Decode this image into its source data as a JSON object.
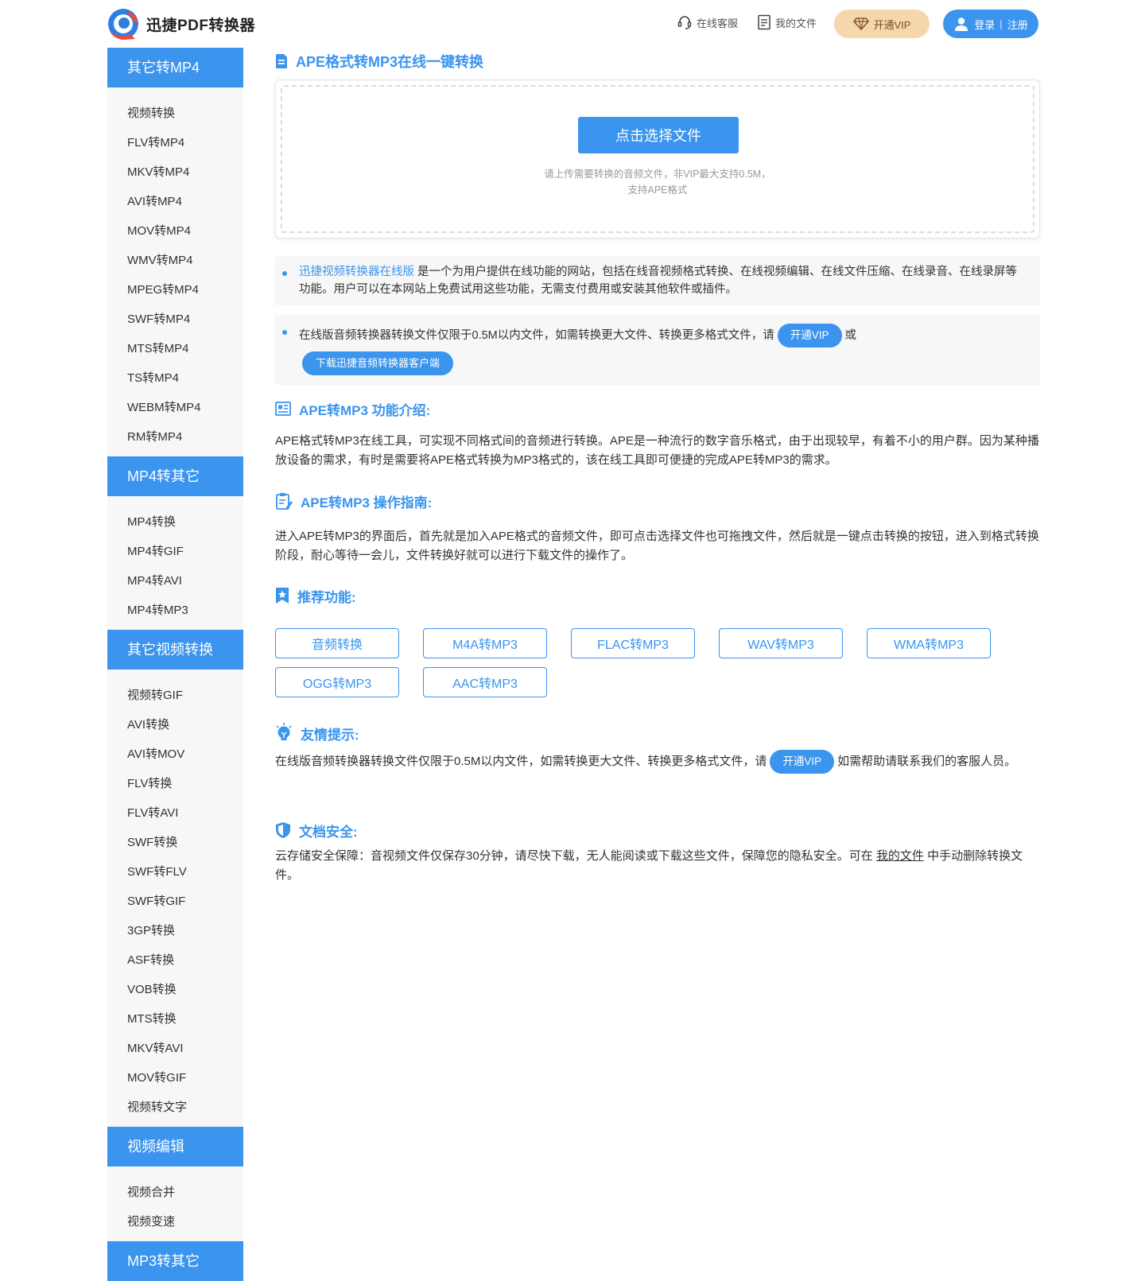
{
  "header": {
    "brand": "迅捷PDF转换器",
    "support": "在线客服",
    "my_files": "我的文件",
    "vip": "开通VIP",
    "login": "登录",
    "register": "注册",
    "login_sep": "|"
  },
  "sidebar": {
    "groups": [
      {
        "title": "其它转MP4",
        "items": [
          "视频转换",
          "FLV转MP4",
          "MKV转MP4",
          "AVI转MP4",
          "MOV转MP4",
          "WMV转MP4",
          "MPEG转MP4",
          "SWF转MP4",
          "MTS转MP4",
          "TS转MP4",
          "WEBM转MP4",
          "RM转MP4"
        ]
      },
      {
        "title": "MP4转其它",
        "items": [
          "MP4转换",
          "MP4转GIF",
          "MP4转AVI",
          "MP4转MP3"
        ]
      },
      {
        "title": "其它视频转换",
        "items": [
          "视频转GIF",
          "AVI转换",
          "AVI转MOV",
          "FLV转换",
          "FLV转AVI",
          "SWF转换",
          "SWF转FLV",
          "SWF转GIF",
          "3GP转换",
          "ASF转换",
          "VOB转换",
          "MTS转换",
          "MKV转AVI",
          "MOV转GIF",
          "视频转文字"
        ]
      },
      {
        "title": "视频编辑",
        "items": [
          "视频合并",
          "视频变速"
        ]
      },
      {
        "title": "MP3转其它",
        "items": []
      }
    ]
  },
  "main": {
    "title": "APE格式转MP3在线一键转换",
    "upload": {
      "button": "点击选择文件",
      "tip_line1": "请上传需要转换的音频文件，非VIP最大支持0.5M，",
      "tip_line2": "支持APE格式"
    },
    "note1": {
      "link": "迅捷视频转换器在线版",
      "text": " 是一个为用户提供在线功能的网站，包括在线音视频格式转换、在线视频编辑、在线文件压缩、在线录音、在线录屏等功能。用户可以在本网站上免费试用这些功能，无需支付费用或安装其他软件或插件。"
    },
    "note2": {
      "text": "在线版音频转换器转换文件仅限于0.5M以内文件，如需转换更大文件、转换更多格式文件，请",
      "vip": "开通VIP",
      "or": "或",
      "download": "下载迅捷音频转换器客户端"
    },
    "intro": {
      "title": "APE转MP3 功能介绍:",
      "text": "APE格式转MP3在线工具，可实现不同格式间的音频进行转换。APE是一种流行的数字音乐格式，由于出现较早，有着不小的用户群。因为某种播放设备的需求，有时是需要将APE格式转换为MP3格式的，该在线工具即可便捷的完成APE转MP3的需求。"
    },
    "guide": {
      "title": "APE转MP3 操作指南:",
      "text": "进入APE转MP3的界面后，首先就是加入APE格式的音频文件，即可点击选择文件也可拖拽文件，然后就是一键点击转换的按钮，进入到格式转换阶段，耐心等待一会儿，文件转换好就可以进行下载文件的操作了。"
    },
    "recommend": {
      "title": "推荐功能:",
      "items": [
        "音频转换",
        "M4A转MP3",
        "FLAC转MP3",
        "WAV转MP3",
        "WMA转MP3",
        "OGG转MP3",
        "AAC转MP3"
      ]
    },
    "tips": {
      "title": "友情提示:",
      "text_before": "在线版音频转换器转换文件仅限于0.5M以内文件，如需转换更大文件、转换更多格式文件，请",
      "vip": "开通VIP",
      "text_after": "如需帮助请联系我们的客服人员。"
    },
    "security": {
      "title": "文档安全:",
      "text_before": "云存储安全保障：音视频文件仅保存30分钟，请尽快下载，无人能阅读或下载这些文件，保障您的隐私安全。可在",
      "link": "我的文件",
      "text_after": "中手动删除转换文件。"
    }
  },
  "colors": {
    "accent": "#3b94ee",
    "sidebar_bg": "#f7f7f7",
    "vip_bg": "#f6d6ac",
    "vip_text": "#7a5128"
  },
  "icons": [
    "logo-icon",
    "headset-icon",
    "file-icon",
    "diamond-icon",
    "user-icon",
    "document-icon",
    "news-icon",
    "clipboard-icon",
    "star-bookmark-icon",
    "bulb-icon",
    "shield-icon"
  ]
}
